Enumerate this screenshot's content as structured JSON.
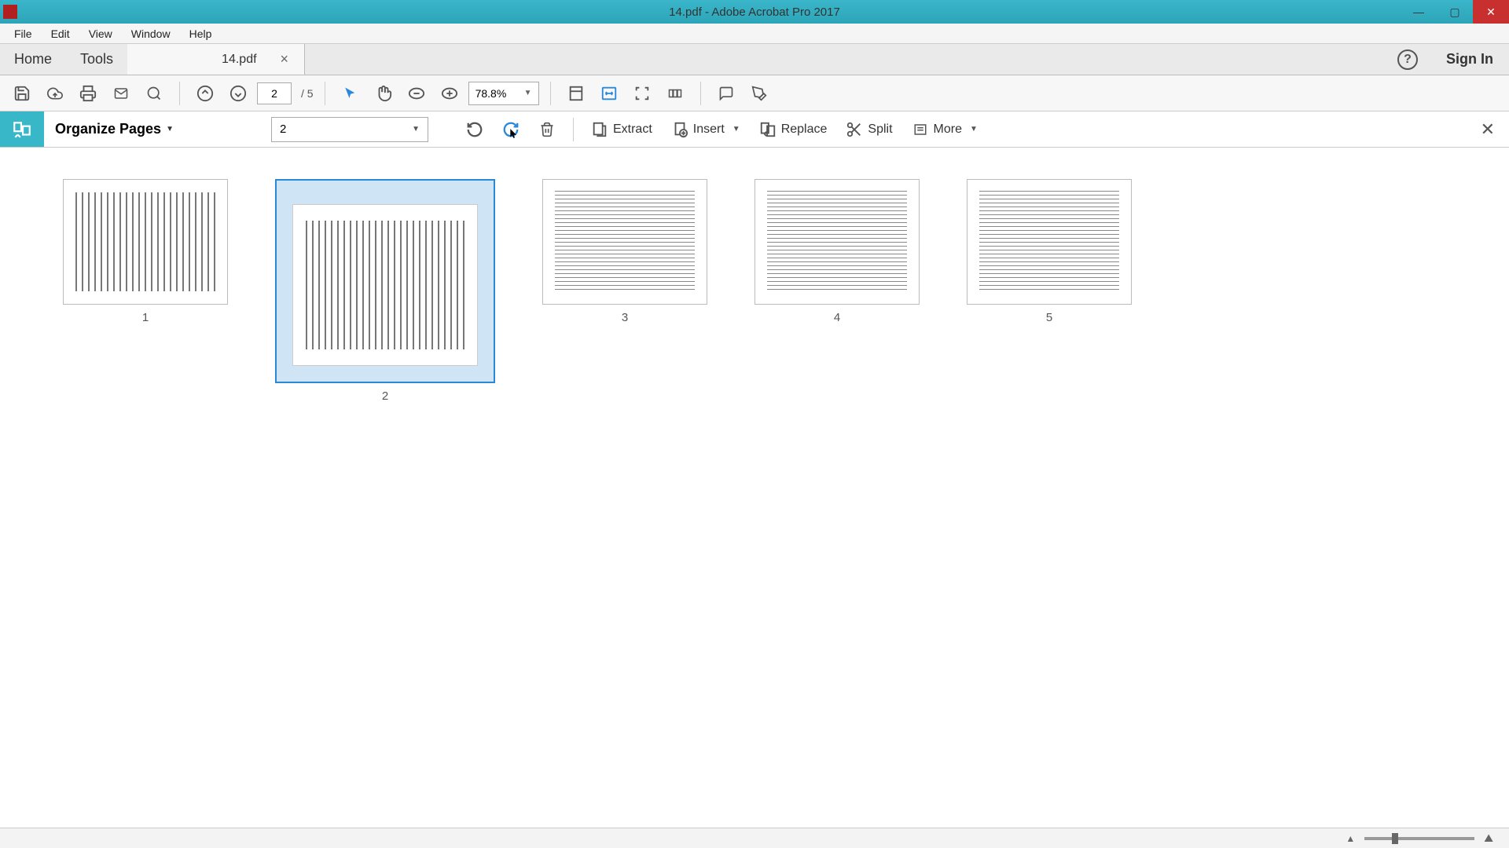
{
  "window": {
    "title": "14.pdf - Adobe Acrobat Pro 2017"
  },
  "menubar": {
    "file": "File",
    "edit": "Edit",
    "view": "View",
    "window": "Window",
    "help": "Help"
  },
  "tabs": {
    "home": "Home",
    "tools": "Tools",
    "doc": "14.pdf",
    "signin": "Sign In"
  },
  "toolbar": {
    "current_page": "2",
    "total_pages": "/  5",
    "zoom": "78.8%"
  },
  "organize": {
    "title": "Organize Pages",
    "page_select": "2",
    "extract": "Extract",
    "insert": "Insert",
    "replace": "Replace",
    "split": "Split",
    "more": "More"
  },
  "thumbnails": [
    {
      "num": "1",
      "rotated": true,
      "selected": false
    },
    {
      "num": "2",
      "rotated": true,
      "selected": true
    },
    {
      "num": "3",
      "rotated": false,
      "selected": false
    },
    {
      "num": "4",
      "rotated": false,
      "selected": false
    },
    {
      "num": "5",
      "rotated": false,
      "selected": false
    }
  ]
}
